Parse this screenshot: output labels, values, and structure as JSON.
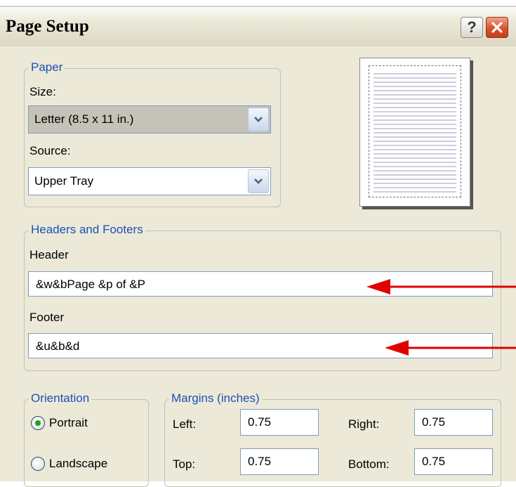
{
  "window": {
    "title": "Page Setup",
    "help_glyph": "?",
    "close_glyph": "✕"
  },
  "paper": {
    "legend": "Paper",
    "size_label": "Size:",
    "size_value": "Letter (8.5 x 11 in.)",
    "source_label": "Source:",
    "source_value": "Upper Tray"
  },
  "headers_footers": {
    "legend": "Headers and Footers",
    "header_label": "Header",
    "header_value": "&w&bPage &p of &P",
    "footer_label": "Footer",
    "footer_value": "&u&b&d"
  },
  "orientation": {
    "legend": "Orientation",
    "portrait_label": "Portrait",
    "landscape_label": "Landscape",
    "selected": "Portrait"
  },
  "margins": {
    "legend": "Margins (inches)",
    "left_label": "Left:",
    "left_value": "0.75",
    "right_label": "Right:",
    "right_value": "0.75",
    "top_label": "Top:",
    "top_value": "0.75",
    "bottom_label": "Bottom:",
    "bottom_value": "0.75"
  },
  "colors": {
    "dialog_bg": "#ece9d8",
    "group_legend": "#1c51b8",
    "annotation_arrow": "#e00000"
  },
  "icons": {
    "help": "help-icon",
    "close": "close-icon",
    "dropdown": "chevron-down-icon",
    "annotation": "red-arrow-icon"
  }
}
